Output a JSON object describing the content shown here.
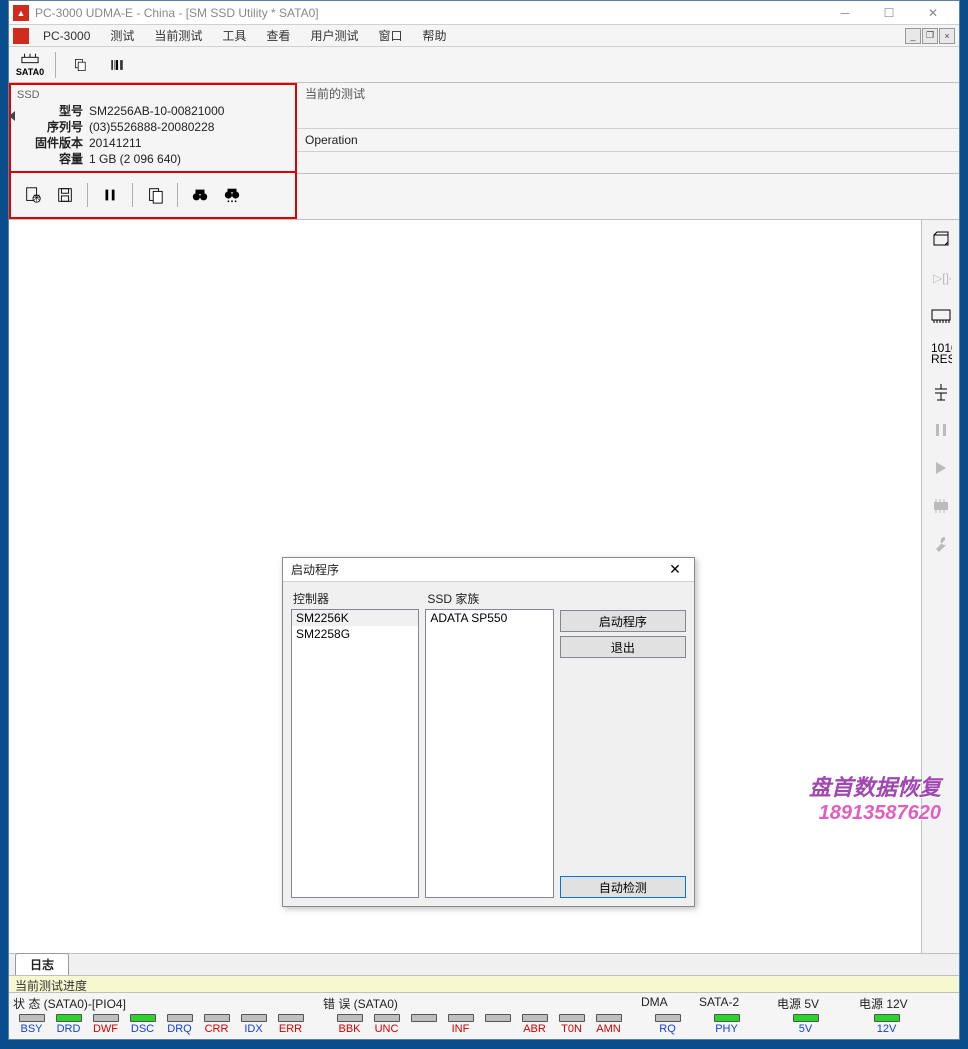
{
  "titlebar": {
    "title": "PC-3000 UDMA-E - China - [SM SSD Utility * SATA0]"
  },
  "menubar": {
    "brand": "PC-3000",
    "items": [
      "测试",
      "当前测试",
      "工具",
      "查看",
      "用户测试",
      "窗口",
      "帮助"
    ]
  },
  "toolbar1": {
    "sata_label": "SATA0"
  },
  "ssd_panel": {
    "header": "SSD",
    "labels": {
      "model": "型号",
      "serial": "序列号",
      "firmware": "固件版本",
      "capacity": "容量"
    },
    "values": {
      "model": "SM2256AB-10-00821000",
      "serial": "(03)5526888-20080228",
      "firmware": "20141211",
      "capacity": "1 GB (2 096 640)"
    }
  },
  "right_panel": {
    "current_test": "当前的测试",
    "operation": "Operation"
  },
  "dialog": {
    "title": "启动程序",
    "controller_label": "控制器",
    "family_label": "SSD 家族",
    "controllers": [
      "SM2256K",
      "SM2258G"
    ],
    "families": [
      "ADATA SP550"
    ],
    "btn_start": "启动程序",
    "btn_exit": "退出",
    "btn_auto": "自动检测"
  },
  "tabs": {
    "log": "日志"
  },
  "progress": {
    "label": "当前测试进度"
  },
  "status": {
    "header_state": "状 态 (SATA0)-[PIO4]",
    "header_err": "错 误 (SATA0)",
    "header_dma": "DMA",
    "header_sata": "SATA-2",
    "header_p5": "电源 5V",
    "header_p12": "电源 12V",
    "state_leds": [
      {
        "lbl": "BSY",
        "on": false,
        "cls": "blue"
      },
      {
        "lbl": "DRD",
        "on": true,
        "cls": "blue"
      },
      {
        "lbl": "DWF",
        "on": false,
        "cls": "red"
      },
      {
        "lbl": "DSC",
        "on": true,
        "cls": "blue"
      },
      {
        "lbl": "DRQ",
        "on": false,
        "cls": "blue"
      },
      {
        "lbl": "CRR",
        "on": false,
        "cls": "red"
      },
      {
        "lbl": "IDX",
        "on": false,
        "cls": "blue"
      },
      {
        "lbl": "ERR",
        "on": false,
        "cls": "red"
      }
    ],
    "err_leds": [
      {
        "lbl": "BBK",
        "on": false,
        "cls": "red"
      },
      {
        "lbl": "UNC",
        "on": false,
        "cls": "red"
      },
      {
        "lbl": "",
        "on": false,
        "cls": "red"
      },
      {
        "lbl": "INF",
        "on": false,
        "cls": "red"
      },
      {
        "lbl": "",
        "on": false,
        "cls": "red"
      },
      {
        "lbl": "ABR",
        "on": false,
        "cls": "red"
      },
      {
        "lbl": "T0N",
        "on": false,
        "cls": "red"
      },
      {
        "lbl": "AMN",
        "on": false,
        "cls": "red"
      }
    ],
    "dma": {
      "lbl": "RQ",
      "on": false,
      "cls": "blue"
    },
    "sata": {
      "lbl": "PHY",
      "on": true,
      "cls": "blue"
    },
    "p5": {
      "lbl": "5V",
      "on": true,
      "cls": "blue"
    },
    "p12": {
      "lbl": "12V",
      "on": true,
      "cls": "blue"
    }
  },
  "watermark": {
    "l1": "盘首数据恢复",
    "l2": "18913587620"
  }
}
